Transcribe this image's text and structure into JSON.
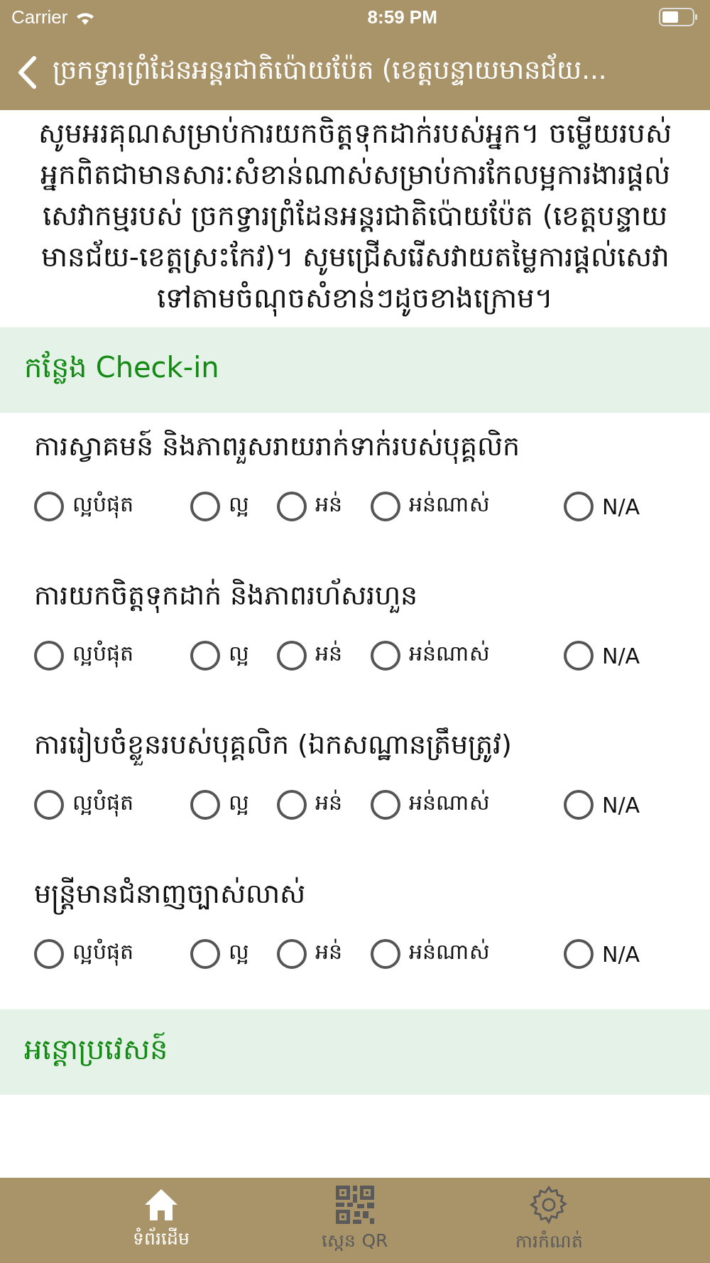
{
  "status_bar": {
    "carrier": "Carrier",
    "time": "8:59 PM"
  },
  "nav": {
    "title": "ច្រកទ្វារព្រំដែនអន្តរជាតិប៉ោយប៉ែត (ខេត្តបន្ទាយមានជ័យ..."
  },
  "intro": "សូមអរគុណសម្រាប់ការយកចិត្តទុកដាក់របស់អ្នក។ ចម្លើយរបស់អ្នកពិតជាមានសារៈសំខាន់ណាស់សម្រាប់ការកែលម្អការងារផ្តល់សេវាកម្មរបស់ ច្រកទ្វារព្រំដែនអន្តរជាតិប៉ោយប៉ែត (ខេត្តបន្ទាយមានជ័យ-ខេត្តស្រះកែវ)។ សូមជ្រើសរើសវាយតម្លៃការផ្តល់សេវាទៅតាមចំណុចសំខាន់ៗដូចខាងក្រោម។",
  "sections": [
    {
      "title": "កន្លែង Check-in",
      "questions": [
        {
          "text": "ការស្វាគមន៍ និងភាពរួសរាយរាក់ទាក់របស់បុគ្គលិក",
          "options": [
            {
              "label": "ល្អបំផុត",
              "selected": false
            },
            {
              "label": "ល្អ",
              "selected": false
            },
            {
              "label": "អន់",
              "selected": false
            },
            {
              "label": "អន់ណាស់",
              "selected": false
            },
            {
              "label": "N/A",
              "selected": false
            }
          ]
        },
        {
          "text": "ការយកចិត្តទុកដាក់ និងភាពរហ័សរហួន",
          "options": [
            {
              "label": "ល្អបំផុត",
              "selected": false
            },
            {
              "label": "ល្អ",
              "selected": false
            },
            {
              "label": "អន់",
              "selected": false
            },
            {
              "label": "អន់ណាស់",
              "selected": false
            },
            {
              "label": "N/A",
              "selected": false
            }
          ]
        },
        {
          "text": "ការរៀបចំខ្លួនរបស់បុគ្គលិក (ឯកសណ្ឋានត្រឹមត្រូវ)",
          "options": [
            {
              "label": "ល្អបំផុត",
              "selected": false
            },
            {
              "label": "ល្អ",
              "selected": false
            },
            {
              "label": "អន់",
              "selected": false
            },
            {
              "label": "អន់ណាស់",
              "selected": false
            },
            {
              "label": "N/A",
              "selected": false
            }
          ]
        },
        {
          "text": "មន្ត្រីមានជំនាញច្បាស់លាស់",
          "options": [
            {
              "label": "ល្អបំផុត",
              "selected": false
            },
            {
              "label": "ល្អ",
              "selected": false
            },
            {
              "label": "អន់",
              "selected": false
            },
            {
              "label": "អន់ណាស់",
              "selected": false
            },
            {
              "label": "N/A",
              "selected": false
            }
          ]
        }
      ]
    },
    {
      "title": "អន្តោប្រវេសន៍"
    }
  ],
  "tabs": [
    {
      "kind": "home",
      "label": "ទំព័រដើម",
      "selected": true
    },
    {
      "kind": "qr",
      "label": "ស្កេន QR",
      "selected": false
    },
    {
      "kind": "settings",
      "label": "ការកំណត់",
      "selected": false
    }
  ]
}
